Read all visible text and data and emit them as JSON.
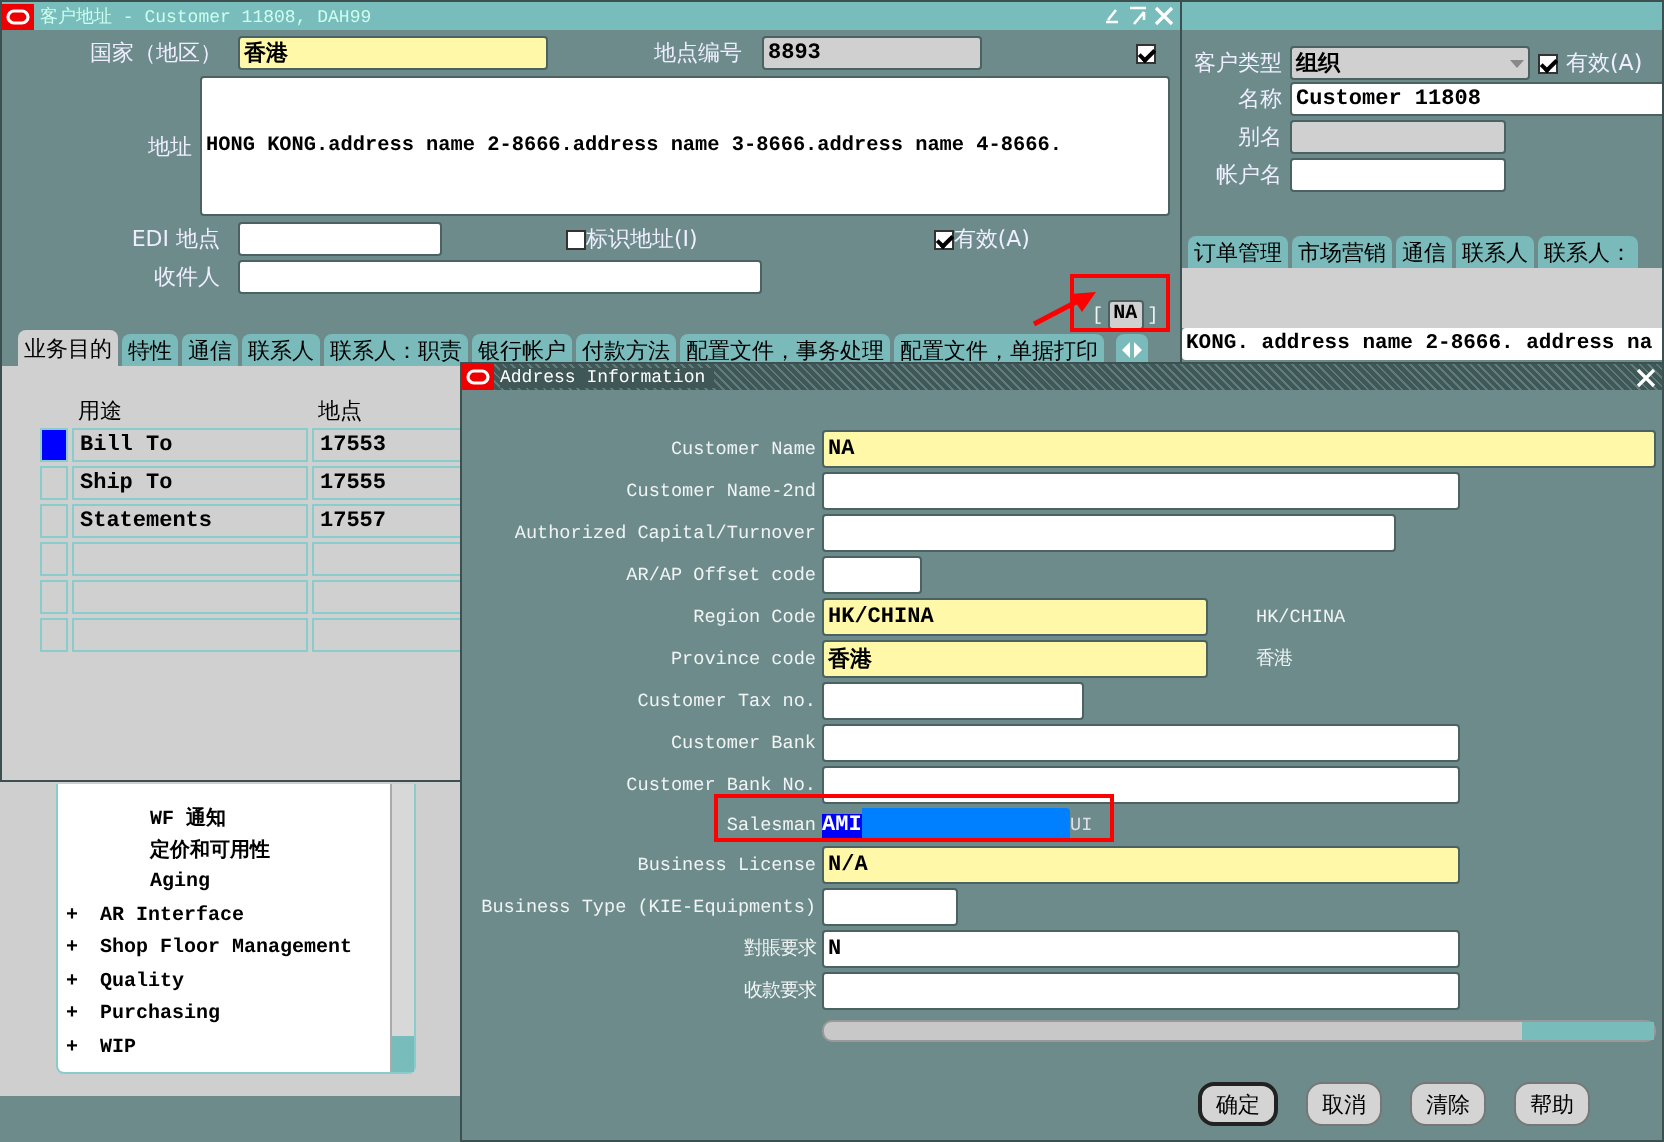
{
  "address_window": {
    "title": "客户地址 - Customer 11808, DAH99",
    "country": {
      "label": "国家（地区）",
      "value": "香港"
    },
    "site_number": {
      "label": "地点编号",
      "value": "8893"
    },
    "top_checkbox": {
      "checked": true
    },
    "address": {
      "label": "地址",
      "value": "HONG KONG.address name 2-8666.address name 3-8666.address name 4-8666."
    },
    "edi": {
      "label": "EDI 地点"
    },
    "identify_address": {
      "label": "标识地址(I)",
      "checked": false
    },
    "recipient": {
      "label": "收件人"
    },
    "active": {
      "label": "有效(A)",
      "checked": true
    },
    "flex_field": {
      "value": "NA",
      "open": "[",
      "close": "]"
    },
    "tabs": [
      {
        "label": "业务目的",
        "selected": true
      },
      {
        "label": "特性",
        "selected": false
      },
      {
        "label": "通信",
        "selected": false
      },
      {
        "label": "联系人",
        "selected": false
      },
      {
        "label": "联系人：职责",
        "selected": false
      },
      {
        "label": "银行帐户",
        "selected": false
      },
      {
        "label": "付款方法",
        "selected": false
      },
      {
        "label": "配置文件，事务处理",
        "selected": false
      },
      {
        "label": "配置文件，单据打印",
        "selected": false
      }
    ],
    "table": {
      "columns": [
        "用途",
        "地点"
      ],
      "rows": [
        {
          "cells": [
            "Bill To",
            "17553"
          ],
          "selected": true
        },
        {
          "cells": [
            "Ship To",
            "17555"
          ],
          "selected": false
        },
        {
          "cells": [
            "Statements",
            "17557"
          ],
          "selected": false
        },
        {
          "cells": [
            "",
            ""
          ],
          "selected": false
        },
        {
          "cells": [
            "",
            ""
          ],
          "selected": false
        },
        {
          "cells": [
            "",
            ""
          ],
          "selected": false
        }
      ]
    }
  },
  "customer_window": {
    "type": {
      "label": "客户类型",
      "value": "组织"
    },
    "active": {
      "label": "有效(A)",
      "checked": true
    },
    "name": {
      "label": "名称",
      "value": "Customer 11808"
    },
    "alias": {
      "label": "别名"
    },
    "account": {
      "label": "帐户名"
    },
    "tabs": [
      {
        "label": "订单管理",
        "selected": false
      },
      {
        "label": "市场营销",
        "selected": false
      },
      {
        "label": "通信",
        "selected": false
      },
      {
        "label": "联系人",
        "selected": false
      },
      {
        "label": "联系人：",
        "selected": false
      }
    ],
    "address_line": "KONG. address name 2-8666. address na"
  },
  "navigator": {
    "items": [
      {
        "kind": "leaf",
        "label": "WF 通知"
      },
      {
        "kind": "leaf",
        "label": "定价和可用性"
      },
      {
        "kind": "leaf",
        "label": "Aging"
      },
      {
        "kind": "node",
        "toggle": "+",
        "label": "AR Interface"
      },
      {
        "kind": "node",
        "toggle": "+",
        "label": "Shop Floor Management"
      },
      {
        "kind": "node",
        "toggle": "+",
        "label": "Quality"
      },
      {
        "kind": "node",
        "toggle": "+",
        "label": "Purchasing"
      },
      {
        "kind": "node",
        "toggle": "+",
        "label": "WIP"
      }
    ]
  },
  "dialog": {
    "title": "Address Information",
    "fields": [
      {
        "kind": "text",
        "label": "Customer Name",
        "value": "NA",
        "required": true
      },
      {
        "kind": "text",
        "label": "Customer Name-2nd",
        "required": false
      },
      {
        "kind": "text",
        "label": "Authorized Capital/Turnover",
        "required": false
      },
      {
        "kind": "text",
        "label": "AR/AP Offset code",
        "required": false
      },
      {
        "kind": "text",
        "label": "Region Code",
        "value": "HK/CHINA",
        "required": true,
        "note": "HK/CHINA"
      },
      {
        "kind": "text",
        "label": "Province code",
        "value": "香港",
        "required": true,
        "note": "香港"
      },
      {
        "kind": "text",
        "label": "Customer Tax no.",
        "required": false
      },
      {
        "kind": "text",
        "label": "Customer Bank",
        "required": false
      },
      {
        "kind": "text",
        "label": "Customer Bank No.",
        "required": false
      },
      {
        "kind": "redacted",
        "label": "Salesman",
        "value": "AMI",
        "tail": "UI",
        "required": false
      },
      {
        "kind": "text",
        "label": "Business License",
        "value": "N/A",
        "required": true
      },
      {
        "kind": "text",
        "label": "Business Type (KIE-Equipments)",
        "required": false
      },
      {
        "kind": "text",
        "label": "對賬要求",
        "value": "N",
        "required": false
      },
      {
        "kind": "text",
        "label": "收款要求",
        "required": false
      }
    ],
    "buttons": [
      {
        "label": "确定",
        "default": true
      },
      {
        "label": "取消",
        "default": false
      },
      {
        "label": "清除",
        "default": false
      },
      {
        "label": "帮助",
        "default": false
      }
    ]
  }
}
